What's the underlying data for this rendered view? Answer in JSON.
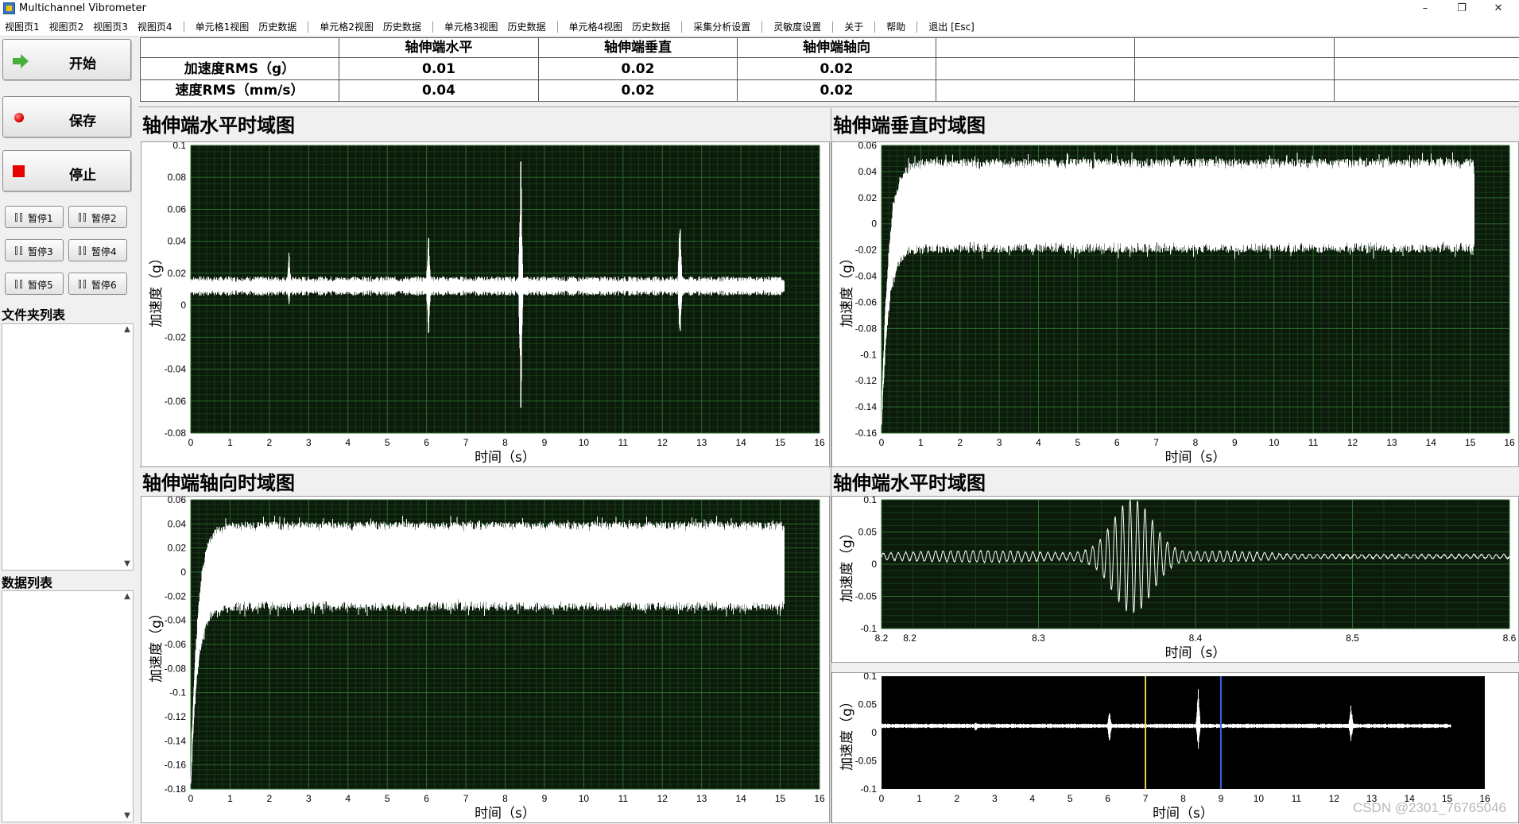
{
  "window": {
    "title": "Multichannel Vibrometer",
    "controls": {
      "minimize": "–",
      "restore": "❐",
      "close": "✕"
    }
  },
  "menu": [
    {
      "label": "视图页1"
    },
    {
      "label": "视图页2"
    },
    {
      "label": "视图页3"
    },
    {
      "label": "视图页4"
    },
    {
      "sep": true
    },
    {
      "label": "单元格1视图"
    },
    {
      "label": "历史数据"
    },
    {
      "sep": true
    },
    {
      "label": "单元格2视图"
    },
    {
      "label": "历史数据"
    },
    {
      "sep": true
    },
    {
      "label": "单元格3视图"
    },
    {
      "label": "历史数据"
    },
    {
      "sep": true
    },
    {
      "label": "单元格4视图"
    },
    {
      "label": "历史数据"
    },
    {
      "sep": true
    },
    {
      "label": "采集分析设置"
    },
    {
      "sep": true
    },
    {
      "label": "灵敏度设置"
    },
    {
      "sep": true
    },
    {
      "label": "关于"
    },
    {
      "sep": true
    },
    {
      "label": "帮助"
    },
    {
      "sep": true
    },
    {
      "label": "退出 [Esc]"
    }
  ],
  "controls": {
    "start": "开始",
    "save": "保存",
    "stop": "停止",
    "pause_buttons": [
      "暂停1",
      "暂停2",
      "暂停3",
      "暂停4",
      "暂停5",
      "暂停6"
    ],
    "folder_list_label": "文件夹列表",
    "data_list_label": "数据列表"
  },
  "rms_table": {
    "headers": [
      "",
      "轴伸端水平",
      "轴伸端垂直",
      "轴伸端轴向",
      "",
      "",
      ""
    ],
    "rows": [
      [
        "加速度RMS（g）",
        "0.01",
        "0.02",
        "0.02",
        "",
        "",
        ""
      ],
      [
        "速度RMS（mm/s）",
        "0.04",
        "0.02",
        "0.02",
        "",
        "",
        ""
      ]
    ]
  },
  "colors": {
    "plot_bg": "#0b1a0b",
    "grid_major": "#2e6b2e",
    "grid_minor": "#173a17",
    "trace": "#ffffff",
    "cursor1": "#e8d050",
    "cursor2": "#3f62e0"
  },
  "watermark": "CSDN @2301_76765046",
  "chart_data": [
    {
      "type": "line",
      "title": "轴伸端水平时域图",
      "xlabel": "时间（s）",
      "ylabel": "加速度（g）",
      "xlim": [
        0,
        16
      ],
      "ylim": [
        -0.08,
        0.1
      ],
      "xticks": [
        0,
        1,
        2,
        3,
        4,
        5,
        6,
        7,
        8,
        9,
        10,
        11,
        12,
        13,
        14,
        15,
        16
      ],
      "yticks": [
        -0.08,
        -0.06,
        -0.04,
        -0.02,
        0,
        0.02,
        0.04,
        0.06,
        0.08,
        0.1
      ],
      "grid": true,
      "series": [
        {
          "signal": {
            "kind": "noise",
            "x_end": 15.1,
            "center": 0.012,
            "band": 0.006,
            "spikes": [
              {
                "x": 2.5,
                "hi": 0.034,
                "lo": 0.0
              },
              {
                "x": 6.05,
                "hi": 0.05,
                "lo": -0.025
              },
              {
                "x": 8.4,
                "hi": 0.098,
                "lo": -0.072
              },
              {
                "x": 12.45,
                "hi": 0.065,
                "lo": -0.03
              }
            ]
          }
        }
      ]
    },
    {
      "type": "line",
      "title": "轴伸端垂直时域图",
      "xlabel": "时间（s）",
      "ylabel": "加速度（g）",
      "xlim": [
        0,
        16
      ],
      "ylim": [
        -0.16,
        0.06
      ],
      "xticks": [
        0,
        1,
        2,
        3,
        4,
        5,
        6,
        7,
        8,
        9,
        10,
        11,
        12,
        13,
        14,
        15,
        16
      ],
      "yticks": [
        -0.16,
        -0.14,
        -0.12,
        -0.1,
        -0.08,
        -0.06,
        -0.04,
        -0.02,
        0,
        0.02,
        0.04,
        0.06
      ],
      "grid": true,
      "series": [
        {
          "signal": {
            "kind": "band",
            "x_end": 15.1,
            "upper": 0.046,
            "lower": -0.018,
            "start": -0.155,
            "rise": 0.7,
            "jitter": 0.004
          }
        }
      ]
    },
    {
      "type": "line",
      "title": "轴伸端轴向时域图",
      "xlabel": "时间（s）",
      "ylabel": "加速度（g）",
      "xlim": [
        0,
        16
      ],
      "ylim": [
        -0.18,
        0.06
      ],
      "xticks": [
        0,
        1,
        2,
        3,
        4,
        5,
        6,
        7,
        8,
        9,
        10,
        11,
        12,
        13,
        14,
        15,
        16
      ],
      "yticks": [
        -0.18,
        -0.16,
        -0.14,
        -0.12,
        -0.1,
        -0.08,
        -0.06,
        -0.04,
        -0.02,
        0,
        0.02,
        0.04,
        0.06
      ],
      "grid": true,
      "series": [
        {
          "signal": {
            "kind": "band",
            "x_end": 15.1,
            "upper": 0.038,
            "lower": -0.028,
            "start": -0.175,
            "rise": 0.7,
            "jitter": 0.004
          }
        }
      ]
    },
    {
      "type": "line",
      "title": "轴伸端水平时域图",
      "xlabel": "时间（s）",
      "ylabel": "加速度（g）",
      "xlim": [
        8.2,
        8.6
      ],
      "ylim": [
        -0.1,
        0.1
      ],
      "xticks": [
        8.2,
        8.3,
        8.4,
        8.5,
        8.6
      ],
      "xtick_labels": [
        "8.2",
        "8.2",
        "8.3",
        "8.4",
        "8.5",
        "8.6"
      ],
      "yticks": [
        -0.1,
        -0.05,
        0,
        0.05,
        0.1
      ],
      "grid": true,
      "series": [
        {
          "signal": {
            "kind": "burst",
            "center": 0.012,
            "burst_x": 8.36,
            "burst_amp": 0.085,
            "burst_width": 0.018
          }
        }
      ]
    },
    {
      "type": "line",
      "title": "",
      "xlabel": "时间（s）",
      "ylabel": "加速度（g）",
      "xlim": [
        0,
        16
      ],
      "ylim": [
        -0.1,
        0.1
      ],
      "xticks": [
        0,
        1,
        2,
        3,
        4,
        5,
        6,
        7,
        8,
        9,
        10,
        11,
        12,
        13,
        14,
        15,
        16
      ],
      "yticks": [
        -0.1,
        -0.05,
        0,
        0.05,
        0.1
      ],
      "grid": false,
      "cursors": [
        7,
        9
      ],
      "series": [
        {
          "signal": {
            "kind": "noise",
            "x_end": 15.1,
            "center": 0.012,
            "band": 0.004,
            "spikes": [
              {
                "x": 2.5,
                "hi": 0.02,
                "lo": 0.0
              },
              {
                "x": 6.05,
                "hi": 0.04,
                "lo": -0.02
              },
              {
                "x": 8.4,
                "hi": 0.08,
                "lo": -0.03
              },
              {
                "x": 12.45,
                "hi": 0.055,
                "lo": -0.02
              }
            ]
          }
        }
      ]
    }
  ]
}
